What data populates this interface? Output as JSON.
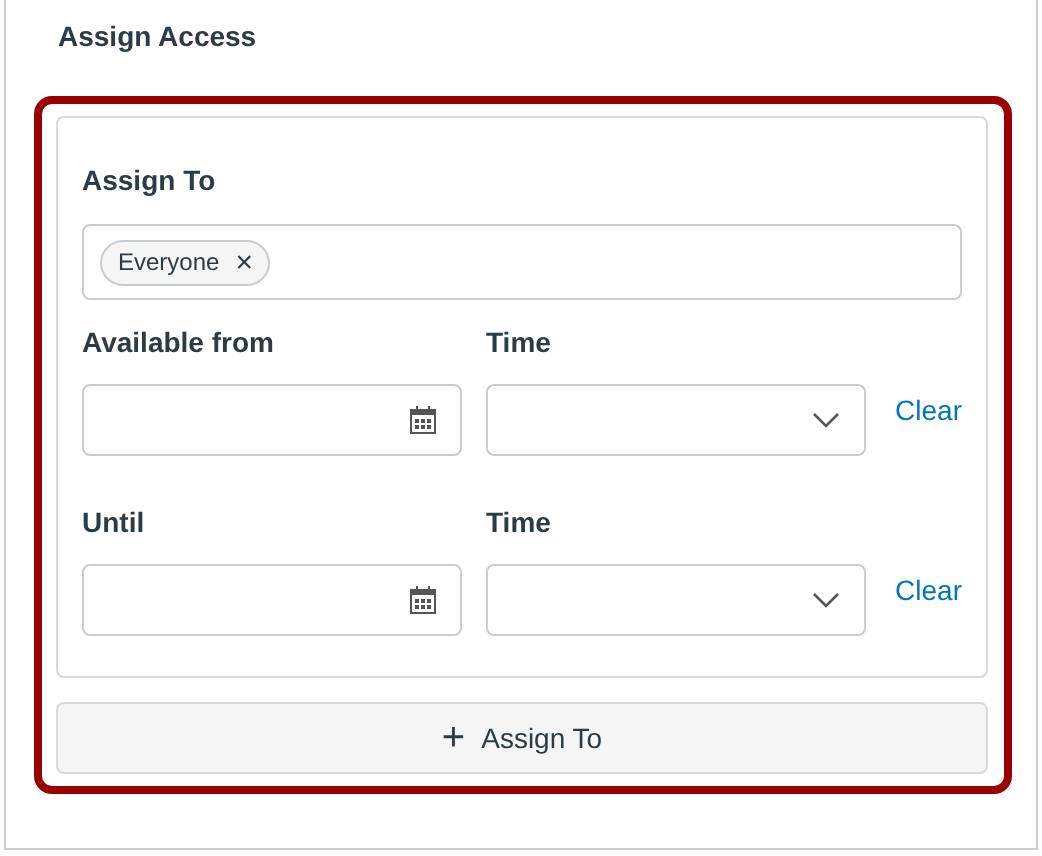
{
  "title": "Assign Access",
  "assign_to": {
    "label": "Assign To",
    "tags": [
      {
        "label": "Everyone",
        "remove": "×"
      }
    ]
  },
  "date_rows": [
    {
      "date_label": "Available from",
      "time_label": "Time",
      "clear": "Clear"
    },
    {
      "date_label": "Until",
      "time_label": "Time",
      "clear": "Clear"
    }
  ],
  "add_button": {
    "icon": "+",
    "label": "Assign To"
  }
}
